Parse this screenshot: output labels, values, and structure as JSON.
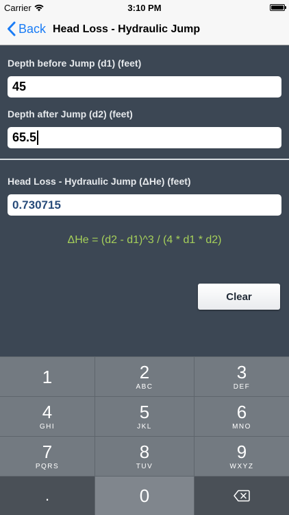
{
  "status_bar": {
    "carrier": "Carrier",
    "time": "3:10 PM"
  },
  "nav": {
    "back_label": "Back",
    "title": "Head Loss - Hydraulic Jump"
  },
  "form": {
    "d1_label": "Depth before Jump (d1) (feet)",
    "d1_value": "45",
    "d2_label": "Depth after Jump (d2) (feet)",
    "d2_value": "65.5",
    "result_label": "Head Loss - Hydraulic Jump (ΔHe) (feet)",
    "result_value": "0.730715",
    "formula": "ΔHe =  (d2 - d1)^3 / (4 * d1 * d2)",
    "clear_label": "Clear"
  },
  "keypad": {
    "keys": [
      {
        "num": "1",
        "letters": ""
      },
      {
        "num": "2",
        "letters": "ABC"
      },
      {
        "num": "3",
        "letters": "DEF"
      },
      {
        "num": "4",
        "letters": "GHI"
      },
      {
        "num": "5",
        "letters": "JKL"
      },
      {
        "num": "6",
        "letters": "MNO"
      },
      {
        "num": "7",
        "letters": "PQRS"
      },
      {
        "num": "8",
        "letters": "TUV"
      },
      {
        "num": "9",
        "letters": "WXYZ"
      },
      {
        "num": ".",
        "letters": ""
      },
      {
        "num": "0",
        "letters": ""
      }
    ]
  },
  "colors": {
    "background": "#3c4754",
    "accent": "#1a7cf5",
    "formula": "#a6d05a",
    "result_text": "#274b7a"
  },
  "icons": {
    "back": "chevron-left-icon",
    "wifi": "wifi-icon",
    "battery": "battery-icon",
    "delete": "backspace-icon"
  }
}
